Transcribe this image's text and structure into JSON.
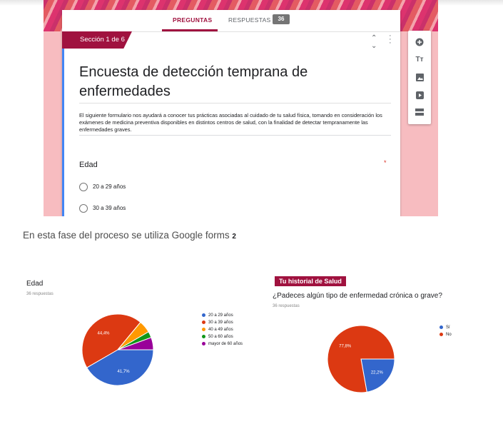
{
  "tabs": {
    "questions": "PREGUNTAS",
    "responses": "RESPUESTAS",
    "responses_count": "36"
  },
  "section": {
    "label": "Sección 1 de 6"
  },
  "form": {
    "title": "Encuesta de detección temprana de enfermedades",
    "description": "El siguiente formulario nos ayudará a conocer tus prácticas asociadas al cuidado de tu salud física,  tomando en consideración los exámenes de medicina preventiva disponibles en distintos centros de salud, con la finalidad de detectar tempranamente las enfermedades graves.",
    "question": {
      "title": "Edad",
      "required_mark": "*",
      "options": [
        "20 a 29 años",
        "30 a 39 años"
      ]
    }
  },
  "toolbar": {
    "icons": [
      "add-question-icon",
      "title-text-icon",
      "image-icon",
      "video-icon",
      "section-icon"
    ]
  },
  "caption": {
    "text": "En esta fase del proceso se utiliza Google forms ",
    "footnote": "2"
  },
  "colors": {
    "brand": "#a0123f",
    "blue": "#3366cc",
    "red": "#dc3912",
    "orange": "#ff9900",
    "green": "#109618",
    "purple": "#990099"
  },
  "chart_data": [
    {
      "type": "pie",
      "title": "Edad",
      "subtitle": "36 respuestas",
      "categories": [
        "20 a 29 años",
        "30 a 39 años",
        "40 a 49 años",
        "50 a 60 años",
        "mayor de 60 años"
      ],
      "values": [
        41.7,
        44.4,
        5.6,
        2.8,
        5.6
      ],
      "labels": [
        "41,7%",
        "44,4%",
        "",
        "",
        ""
      ],
      "colors": [
        "#3366cc",
        "#dc3912",
        "#ff9900",
        "#109618",
        "#990099"
      ],
      "legend": "right"
    },
    {
      "type": "pie",
      "section_tag": "Tu historial de Salud",
      "title": "¿Padeces algún tipo de enfermedad crónica o grave?",
      "subtitle": "36 respuestas",
      "categories": [
        "Sí",
        "No"
      ],
      "values": [
        22.2,
        77.8
      ],
      "labels": [
        "22,2%",
        "77,8%"
      ],
      "colors": [
        "#3366cc",
        "#dc3912"
      ],
      "legend": "right"
    }
  ]
}
